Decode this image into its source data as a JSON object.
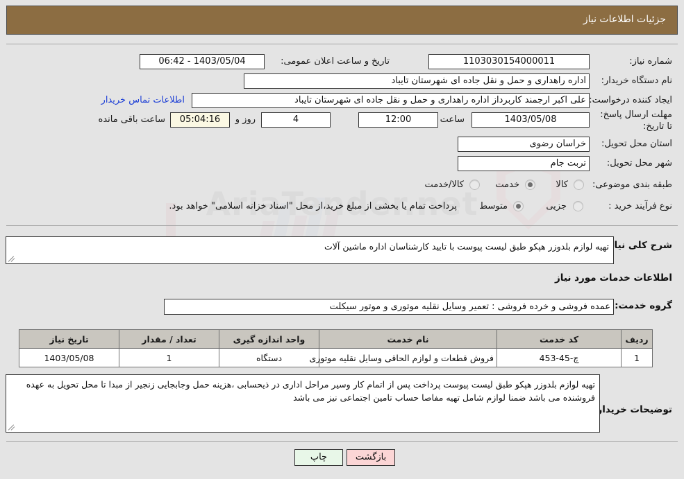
{
  "header": {
    "title": "جزئیات اطلاعات نیاز"
  },
  "summary": {
    "need_number_label": "شماره نیاز:",
    "need_number_value": "1103030154000011",
    "announce_label": "تاریخ و ساعت اعلان عمومی:",
    "announce_value": "1403/05/04 - 06:42",
    "buyer_org_label": "نام دستگاه خریدار:",
    "buyer_org_value": "اداره راهداری و حمل و نقل جاده ای شهرستان تایباد",
    "creator_label": "ایجاد کننده درخواست:",
    "creator_value": "علی اکبر ارجمند کاربرداز اداره راهداری و حمل و نقل جاده ای شهرستان تایباد",
    "contact_link": "اطلاعات تماس خریدار",
    "deadline_label": "مهلت ارسال پاسخ: تا تاریخ:",
    "deadline_date": "1403/05/08",
    "hour_label": "ساعت",
    "deadline_time": "12:00",
    "days_value": "4",
    "days_label": "روز و",
    "countdown_value": "05:04:16",
    "countdown_label": "ساعت باقی مانده",
    "province_label": "استان محل تحویل:",
    "province_value": "خراسان رضوی",
    "city_label": "شهر محل تحویل:",
    "city_value": "تربت جام",
    "category_label": "طبقه بندی موضوعی:",
    "category_options": [
      {
        "label": "کالا",
        "selected": false
      },
      {
        "label": "خدمت",
        "selected": true
      },
      {
        "label": "کالا/خدمت",
        "selected": false
      }
    ],
    "process_label": "نوع فرآیند خرید :",
    "process_options": [
      {
        "label": "جزیی",
        "selected": false
      },
      {
        "label": "متوسط",
        "selected": false
      }
    ],
    "payment_note": "پرداخت تمام یا بخشی از مبلغ خرید،از محل \"اسناد خزانه اسلامی\" خواهد بود."
  },
  "details": {
    "need_desc_label": "شرح کلی نیاز:",
    "need_desc_value": "تهیه لوازم بلدوزر هپکو طبق لیست پیوست با تایید کارشناسان اداره ماشین آلات",
    "services_heading": "اطلاعات خدمات مورد نیاز",
    "service_group_label": "گروه خدمت:",
    "service_group_value": "عمده فروشی و خرده فروشی : تعمیر وسایل نقلیه موتوری و موتور سیکلت",
    "buyer_notes_label": "توضیحات خریدار:",
    "buyer_notes_value": "تهیه لوازم بلدوزر هپکو طبق لیست پیوست پرداخت پس از اتمام کار وسیر مراحل اداری در ذیحسابی ،هزینه حمل وجابجایی زنجیر از مبدا تا محل تحویل به عهده فروشنده می باشد ضمنا لوازم شامل تهیه  مفاصا حساب تامین اجتماعی  نیز می باشد"
  },
  "table": {
    "columns": [
      "ردیف",
      "کد خدمت",
      "نام خدمت",
      "واحد اندازه گیری",
      "تعداد / مقدار",
      "تاریخ نیاز"
    ],
    "rows": [
      {
        "row_no": "1",
        "service_code": "چ-45-453",
        "service_name": "فروش قطعات و لوازم الحاقی وسایل نقلیه موتوری",
        "unit": "دستگاه",
        "quantity": "1",
        "need_date": "1403/05/08"
      }
    ]
  },
  "buttons": {
    "print": "چاپ",
    "back": "بازگشت"
  },
  "watermark": {
    "text": "AriaTender.net"
  }
}
